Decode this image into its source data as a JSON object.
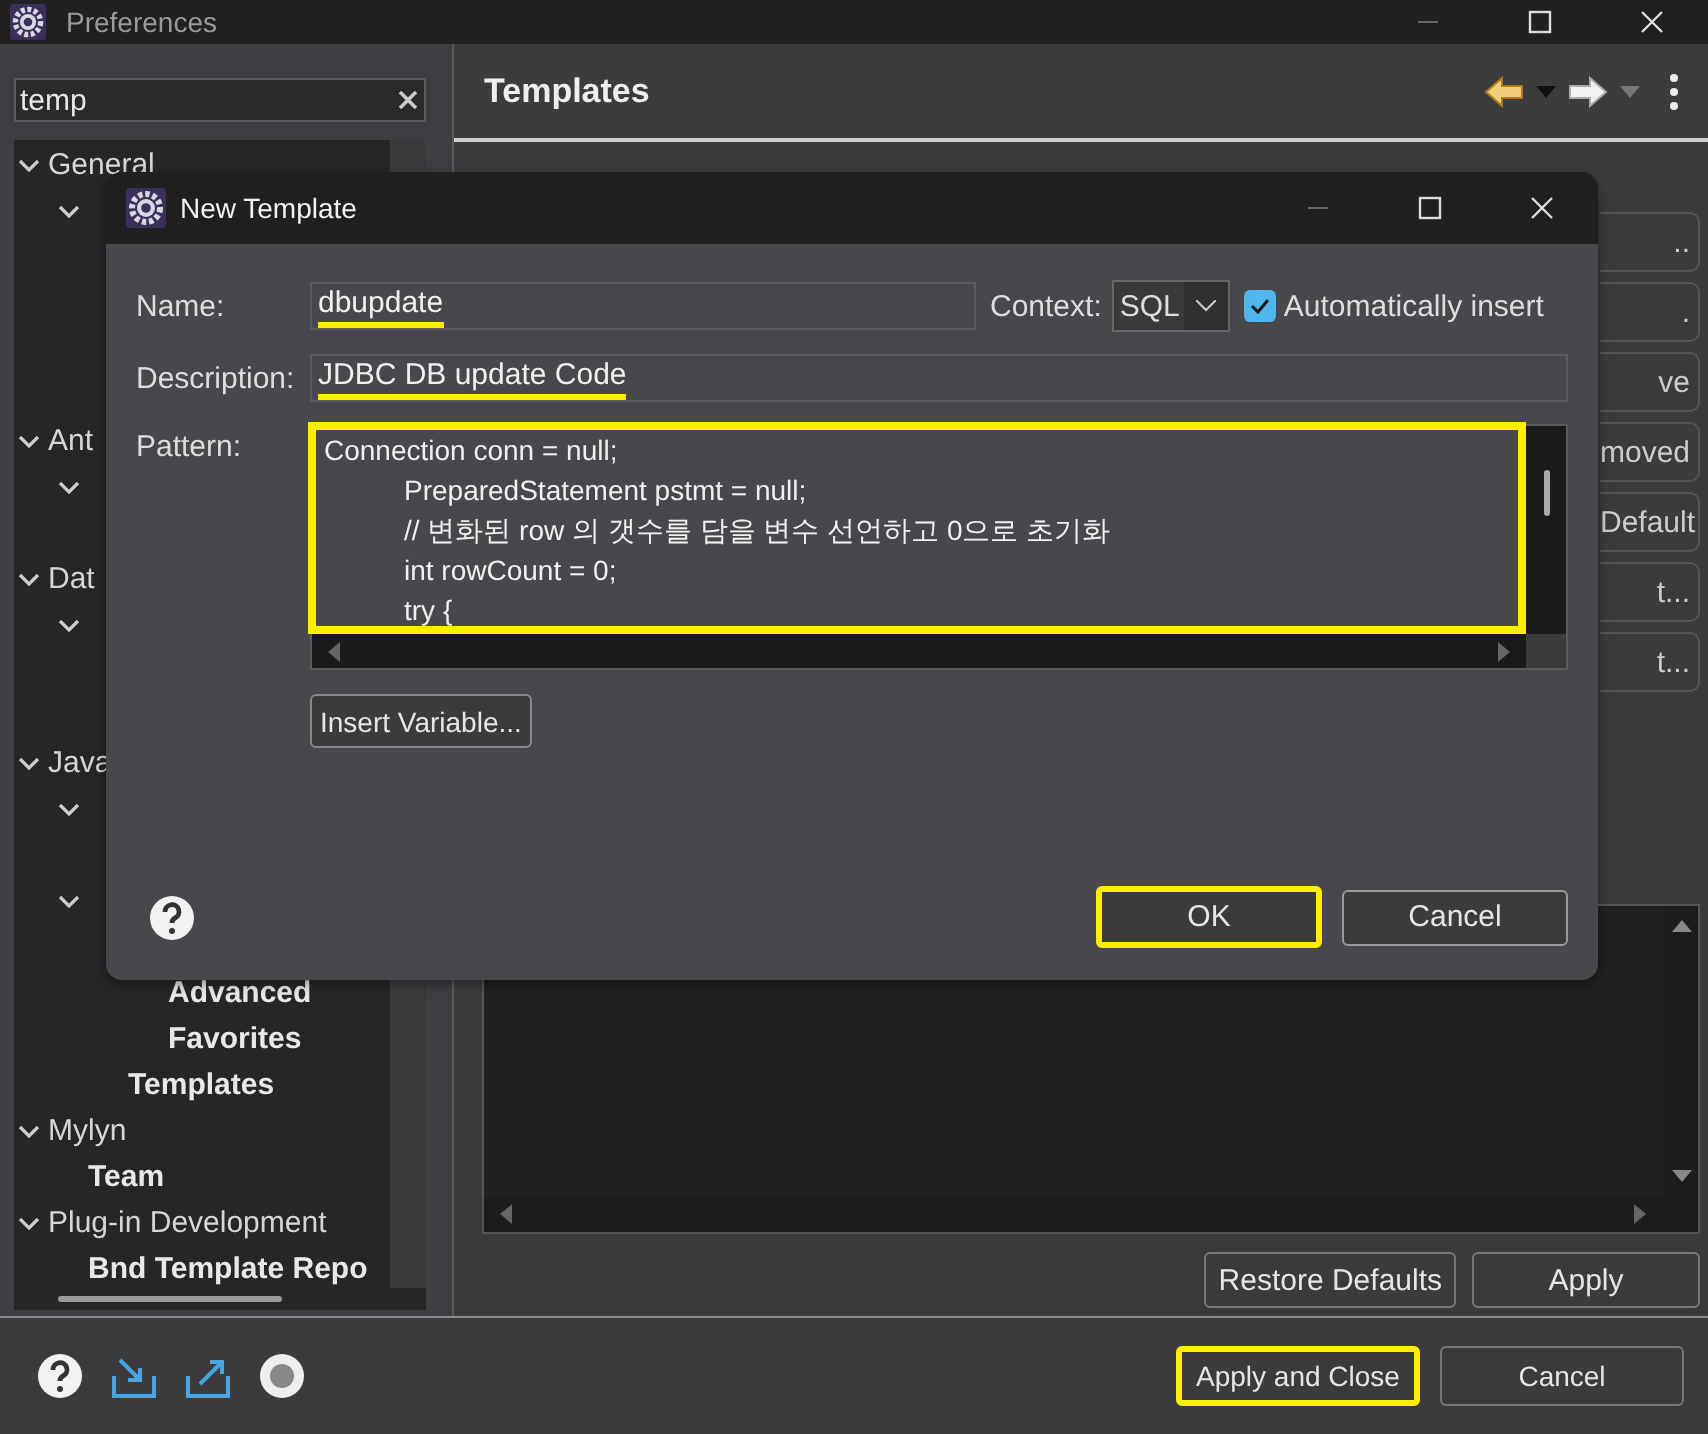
{
  "window": {
    "title": "Preferences"
  },
  "filter": {
    "value": "temp"
  },
  "tree": [
    {
      "label": "General",
      "expanded": true,
      "matched": false,
      "children": [
        {
          "expanded": true,
          "children": [
            {
              "covered": true
            },
            {
              "covered": true
            },
            {
              "covered": true
            },
            {
              "covered": true
            }
          ]
        }
      ]
    },
    {
      "label": "Ant",
      "expanded": true,
      "matched": false,
      "children": [
        {
          "expanded": true,
          "children": [
            {
              "covered": true
            }
          ]
        }
      ]
    },
    {
      "label": "Dat",
      "expanded": true,
      "matched": false,
      "children": [
        {
          "expanded": true,
          "children": [
            {
              "covered": true
            },
            {
              "covered": true
            }
          ]
        }
      ]
    },
    {
      "label": "Java",
      "expanded": true,
      "matched": false,
      "children": [
        {
          "expanded": true,
          "children": [
            {
              "covered": true
            }
          ]
        },
        {
          "expanded": true,
          "children": [
            {
              "covered": true,
              "children": [
                {
                  "label": "Advanced",
                  "matched": true
                },
                {
                  "label": "Favorites",
                  "matched": true
                }
              ]
            },
            {
              "label": "Templates",
              "matched": true
            }
          ]
        }
      ]
    },
    {
      "label": "Mylyn",
      "expanded": true,
      "matched": false,
      "children": [
        {
          "label": "Team",
          "matched": true
        }
      ]
    },
    {
      "label": "Plug-in Development",
      "expanded": true,
      "matched": false,
      "children": [
        {
          "label": "Bnd Template Repo",
          "matched": true
        }
      ]
    }
  ],
  "page": {
    "title": "Templates"
  },
  "side_buttons": [
    "..",
    ".",
    "ve",
    "moved",
    "Default",
    "t...",
    "t..."
  ],
  "page_buttons": [
    "Restore Defaults",
    "Apply"
  ],
  "dialog": {
    "title": "New Template",
    "name_label": "Name:",
    "name": {
      "value": "dbupdate",
      "highlighted": true
    },
    "context_label": "Context:",
    "context": "SQL",
    "auto_insert": {
      "label": "Automatically insert",
      "checked": true
    },
    "description_label": "Description:",
    "description": {
      "value": "JDBC DB update Code",
      "highlighted": true
    },
    "pattern_label": "Pattern:",
    "pattern": {
      "highlighted": true,
      "lines": [
        "Connection conn = null;",
        "\tPreparedStatement pstmt = null;",
        "\t// 변화된 row 의 갯수를 담을 변수 선언하고 0으로 초기화",
        "\tint rowCount = 0;",
        "\ttry {"
      ]
    },
    "insert_variable": "Insert Variable...",
    "buttons": [
      {
        "label": "OK",
        "highlighted": true
      },
      {
        "label": "Cancel",
        "highlighted": false
      }
    ]
  },
  "footer_buttons": [
    {
      "label": "Apply and Close",
      "highlighted": true
    },
    {
      "label": "Cancel",
      "highlighted": false
    }
  ]
}
